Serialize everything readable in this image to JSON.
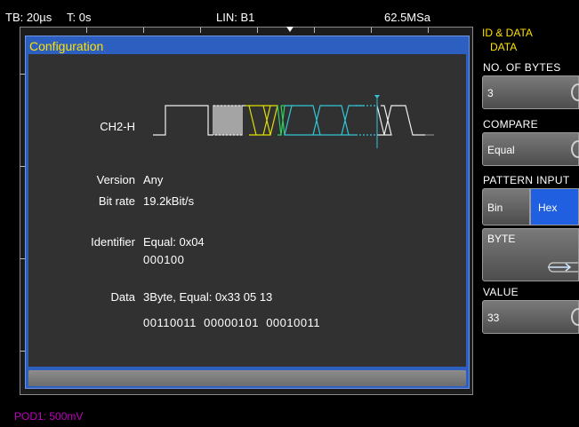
{
  "topbar": {
    "timebase": "TB: 20µs",
    "trigger_time": "T: 0s",
    "trigger_source": "LIN: B1",
    "sample_rate": "62.5MSa"
  },
  "dialog": {
    "title": "Configuration",
    "channel": "CH2-H",
    "version_label": "Version",
    "version_value": "Any",
    "bitrate_label": "Bit rate",
    "bitrate_value": "19.2kBit/s",
    "identifier_label": "Identifier",
    "identifier_value": "Equal: 0x04",
    "identifier_bits": "000100",
    "data_label": "Data",
    "data_value": "3Byte, Equal: 0x33 05 13",
    "data_bits": "00110011  00000101  00010011"
  },
  "sidebar": {
    "title": "ID & DATA",
    "subtitle": "DATA",
    "num_bytes_label": "NO. OF BYTES",
    "num_bytes_value": "3",
    "compare_label": "COMPARE",
    "compare_value": "Equal",
    "pattern_label": "PATTERN INPUT",
    "pattern_bin": "Bin",
    "pattern_hex": "Hex",
    "byte_label": "BYTE",
    "value_label": "VALUE",
    "value_value": "33"
  },
  "status": {
    "pod": "POD1: 500mV"
  },
  "colors": {
    "accent_yellow": "#ffe000",
    "dialog_blue": "#2d5fc0",
    "hex_selected": "#1f5fe0",
    "pod_magenta": "#c000c0",
    "wave_yellow": "#e0e000",
    "wave_green": "#30d060",
    "wave_cyan": "#30c8d8",
    "wave_white": "#f0f0f0"
  },
  "icons": {
    "knob": "rotary-knob-icon",
    "byte_arrow": "arrow-right-loop-icon"
  }
}
